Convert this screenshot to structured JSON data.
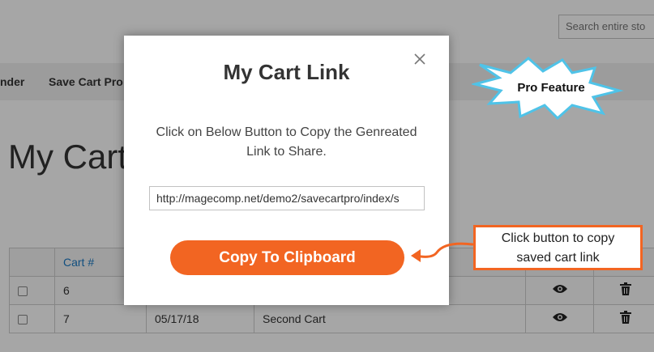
{
  "header": {
    "search_placeholder": "Search entire sto"
  },
  "nav": {
    "items": [
      "nder",
      "Save Cart Pro"
    ]
  },
  "page_title": "My Carts",
  "table": {
    "headers": [
      "",
      "Cart #",
      "",
      "",
      "",
      ""
    ],
    "rows": [
      {
        "id": "6",
        "date": "",
        "name": ""
      },
      {
        "id": "7",
        "date": "05/17/18",
        "name": "Second Cart"
      }
    ]
  },
  "modal": {
    "title": "My Cart Link",
    "message": "Click on Below Button to Copy the Genreated Link to Share.",
    "link_value": "http://magecomp.net/demo2/savecartpro/index/s",
    "copy_button": "Copy To Clipboard",
    "close_icon": "close-icon"
  },
  "annotations": {
    "pro_feature": "Pro Feature",
    "callout_line1": "Click button to copy",
    "callout_line2": "saved cart link"
  },
  "colors": {
    "accent": "#f26522",
    "link": "#1979c3",
    "burst": "#4fc3e8"
  },
  "icons": [
    "eye-icon",
    "trash-icon",
    "close-icon"
  ]
}
